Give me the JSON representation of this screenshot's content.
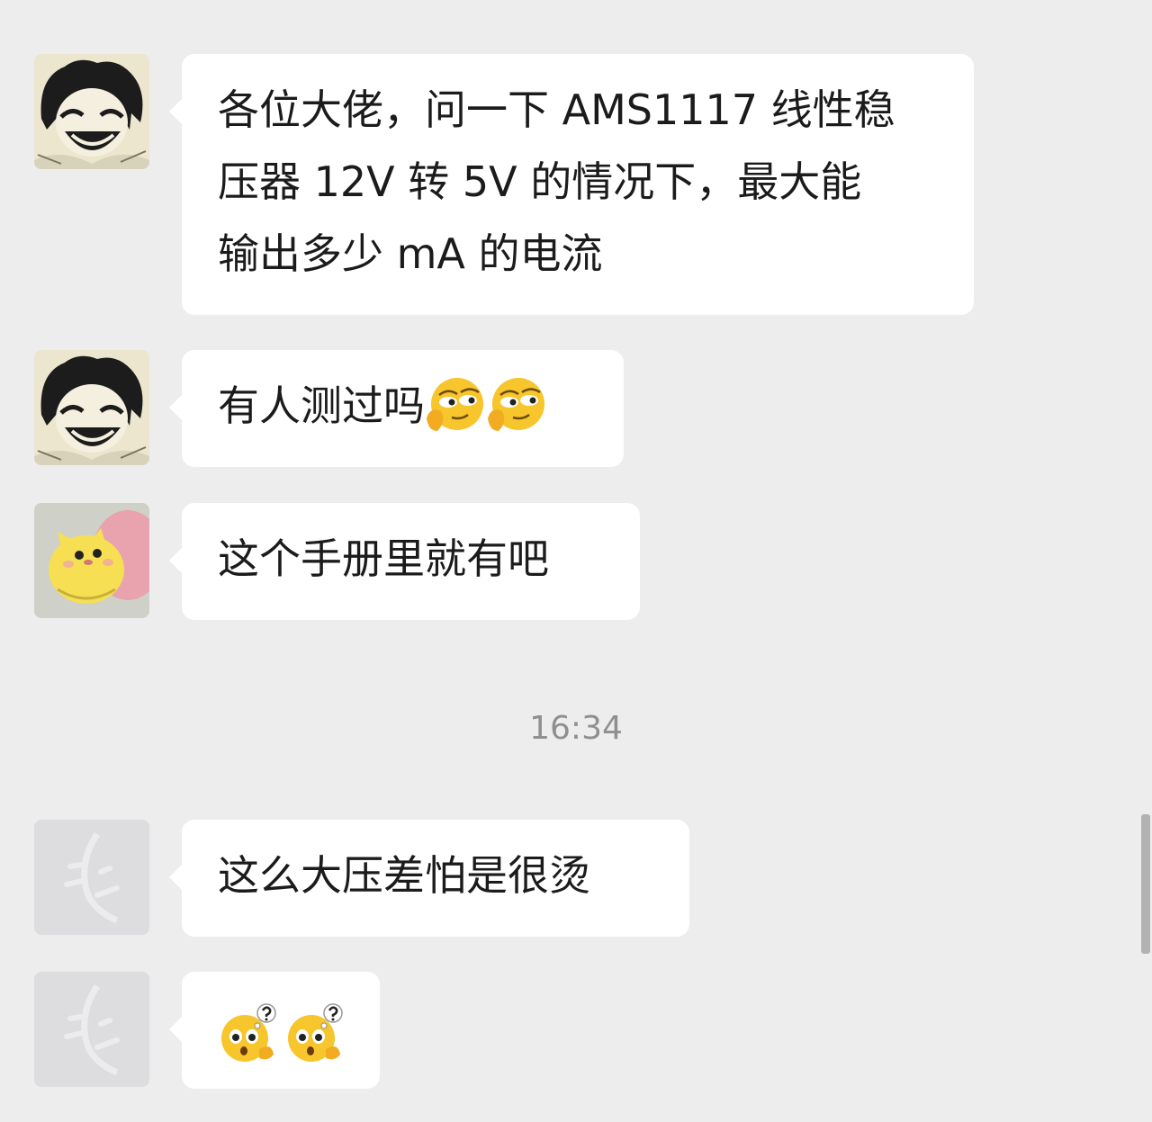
{
  "messages": [
    {
      "avatar": "manga-character-avatar",
      "lines": [
        "各位大佬，问一下 AMS1117 线性稳",
        "压器 12V 转 5V 的情况下，最大能",
        "输出多少 mA 的电流"
      ]
    },
    {
      "avatar": "manga-character-avatar",
      "text": "有人测过吗",
      "emojis": [
        "smirk-emoji",
        "smirk-emoji"
      ]
    },
    {
      "avatar": "yellow-cat-avatar",
      "text": "这个手册里就有吧"
    },
    {
      "avatar": "default-gray-avatar",
      "text": "这么大压差怕是很烫"
    },
    {
      "avatar": "default-gray-avatar",
      "emojis": [
        "confused-question-emoji",
        "confused-question-emoji"
      ]
    }
  ],
  "timestamp": "16:34",
  "colors": {
    "background": "#ededed",
    "bubble": "#ffffff",
    "text": "#1b1b1b",
    "timestamp": "#8f8f8f",
    "emoji_yellow": "#f7c52c"
  }
}
